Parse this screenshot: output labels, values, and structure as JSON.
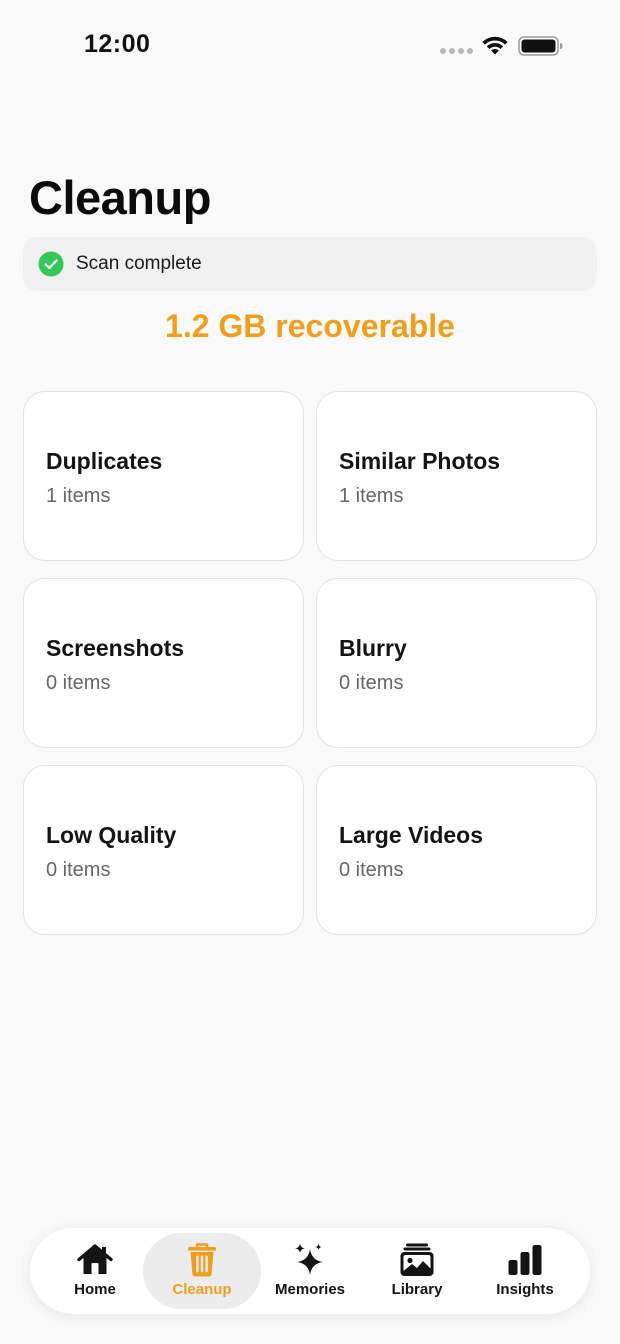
{
  "status_bar": {
    "time": "12:00"
  },
  "header": {
    "title": "Cleanup"
  },
  "scan": {
    "status_text": "Scan complete",
    "recoverable_text": "1.2 GB recoverable"
  },
  "categories": [
    {
      "title": "Duplicates",
      "count": "1 items"
    },
    {
      "title": "Similar Photos",
      "count": "1 items"
    },
    {
      "title": "Screenshots",
      "count": "0 items"
    },
    {
      "title": "Blurry",
      "count": "0 items"
    },
    {
      "title": "Low Quality",
      "count": "0 items"
    },
    {
      "title": "Large Videos",
      "count": "0 items"
    }
  ],
  "tab_bar": {
    "tabs": [
      {
        "label": "Home",
        "icon": "house-icon"
      },
      {
        "label": "Cleanup",
        "icon": "trash-icon",
        "active": true
      },
      {
        "label": "Memories",
        "icon": "sparkles-icon"
      },
      {
        "label": "Library",
        "icon": "photo-stack-icon"
      },
      {
        "label": "Insights",
        "icon": "bar-chart-icon"
      }
    ]
  },
  "colors": {
    "accent": "#ef9f1f",
    "success": "#34c759",
    "background": "#f9f9f9",
    "card": "#ffffff"
  }
}
